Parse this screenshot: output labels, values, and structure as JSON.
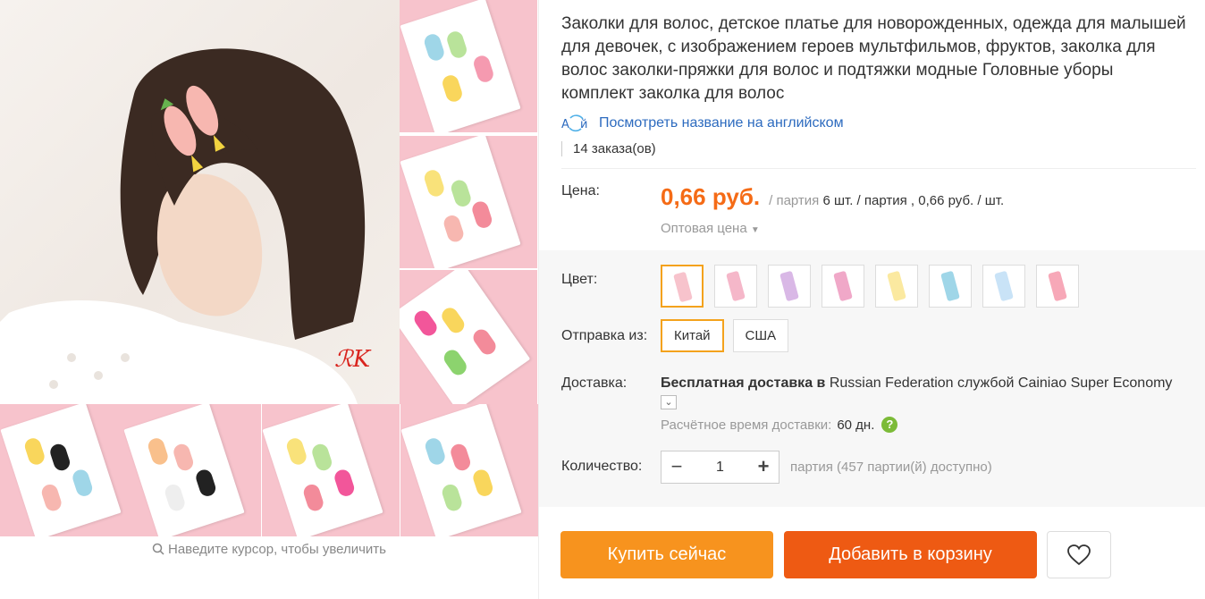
{
  "product": {
    "title": "Заколки для волос, детское платье для новорожденных, одежда для малышей для девочек, с изображением героев мультфильмов, фруктов, заколка для волос заколки-пряжки для волос и подтяжки модные Головные уборы комплект заколка для волос",
    "translate_link": "Посмотреть название на английском",
    "orders": "14 заказа(ов)"
  },
  "gallery": {
    "zoom_hint": "Наведите курсор, чтобы увеличить",
    "thumb_color": "#f7c3cc"
  },
  "price": {
    "label": "Цена:",
    "value": "0,66 руб.",
    "unit_prefix": "/ партия",
    "lot_info": "6 шт. / партия , 0,66 руб. / шт.",
    "wholesale": "Оптовая цена"
  },
  "color": {
    "label": "Цвет:",
    "swatches": [
      "#f7c3cc",
      "#f5b7c9",
      "#d9b8e6",
      "#f0a8c8",
      "#fbe9a0",
      "#9fd6e8",
      "#c9e3f7",
      "#f7a8b8"
    ],
    "selected_index": 0
  },
  "shipping_from": {
    "label": "Отправка из:",
    "options": [
      "Китай",
      "США"
    ],
    "selected": "Китай"
  },
  "delivery": {
    "label": "Доставка:",
    "bold_text": "Бесплатная доставка в",
    "destination": "Russian Federation",
    "service_prefix": "службой",
    "service": "Cainiao Super Economy",
    "estimate_label": "Расчётное время доставки:",
    "estimate_days": "60 дн."
  },
  "quantity": {
    "label": "Количество:",
    "value": "1",
    "availability": "партия (457 партии(й) доступно)"
  },
  "actions": {
    "buy_now": "Купить сейчас",
    "add_to_cart": "Добавить в корзину"
  },
  "colors": {
    "accent_orange": "#f56b16",
    "buy_button": "#f7931e",
    "cart_button": "#ee5a13",
    "selection_border": "#f4a21c",
    "link_blue": "#2d6bbf"
  }
}
